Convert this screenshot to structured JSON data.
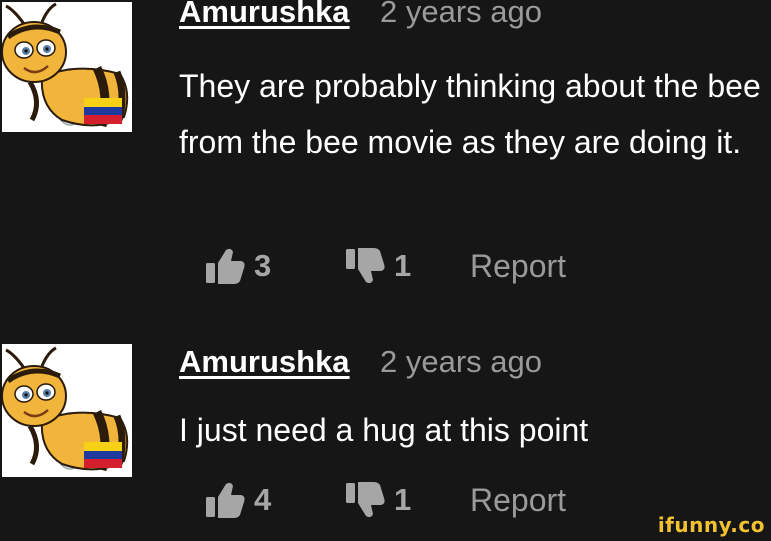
{
  "comments": [
    {
      "username": "Amurushka",
      "timestamp": "2 years ago",
      "text": "They are probably thinking about the bee from the bee movie as they are doing it.",
      "likes": "3",
      "dislikes": "1",
      "report_label": "Report",
      "avatar_icon": "bee-character-avatar"
    },
    {
      "username": "Amurushka",
      "timestamp": "2 years ago",
      "text": "I just need a hug at this point",
      "likes": "4",
      "dislikes": "1",
      "report_label": "Report",
      "avatar_icon": "bee-character-avatar"
    }
  ],
  "watermark": "ifunny.co",
  "colors": {
    "background": "#161616",
    "text": "#ffffff",
    "muted": "#9a9a9a",
    "watermark": "#f2c230"
  }
}
